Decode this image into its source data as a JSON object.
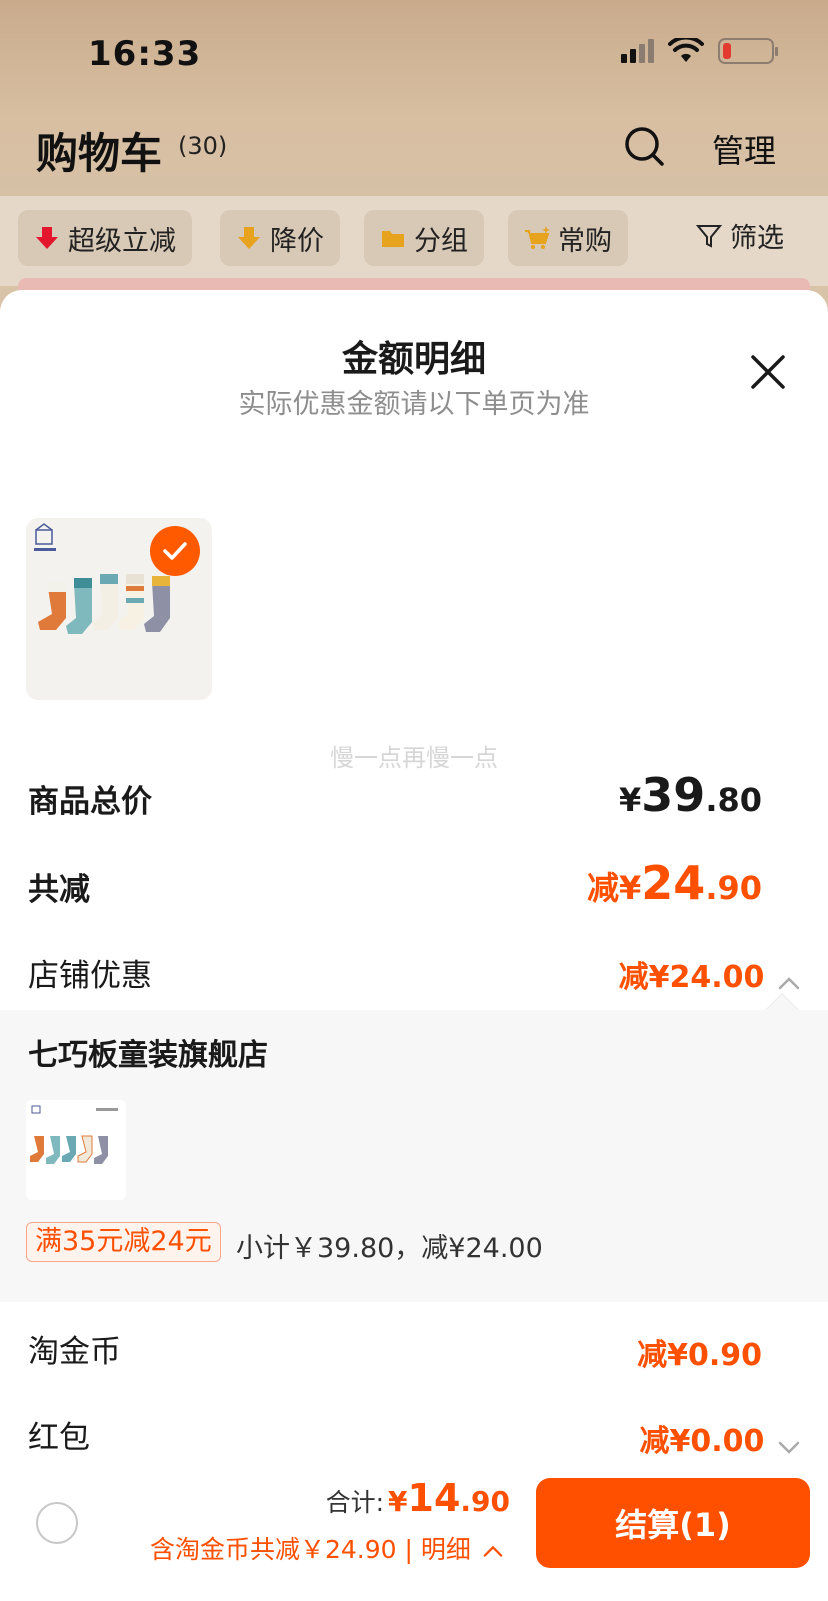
{
  "status_bar": {
    "time": "16:33"
  },
  "header": {
    "title": "购物车",
    "count": "(30)",
    "manage_label": "管理"
  },
  "filters": {
    "chips": [
      {
        "label": "超级立减",
        "icon": "red-down-arrow-icon"
      },
      {
        "label": "降价",
        "icon": "price-drop-arrow-icon"
      },
      {
        "label": "分组",
        "icon": "folder-icon"
      },
      {
        "label": "常购",
        "icon": "cart-sparkle-icon"
      }
    ],
    "filter_label": "筛选"
  },
  "sheet": {
    "title": "金额明细",
    "subtitle": "实际优惠金额请以下单页为准",
    "watermark": "慢一点再慢一点",
    "goods_total": {
      "label": "商品总价",
      "currency": "¥",
      "int": "39",
      "dec": ".80"
    },
    "total_discount": {
      "label": "共减",
      "prefix": "减¥",
      "int": "24",
      "dec": ".90"
    },
    "shop_discount": {
      "label": "店铺优惠",
      "value": "减¥24.00"
    },
    "shop": {
      "name": "七巧板童装旗舰店",
      "coupon": "满35元减24元",
      "subtotal": "小计￥39.80，减¥24.00"
    },
    "coins": {
      "label": "淘金币",
      "value": "减¥0.90"
    },
    "red_packet": {
      "label": "红包",
      "value": "减¥0.00"
    }
  },
  "bottom_bar": {
    "total_label": "合计:",
    "total_currency": "¥",
    "total_int": "14",
    "total_dec": ".90",
    "discount_note": "含淘金币共减￥24.90 | 明细",
    "checkout_label": "结算(1)"
  },
  "colors": {
    "accent": "#ff5000",
    "check_badge": "#ff5a00"
  }
}
